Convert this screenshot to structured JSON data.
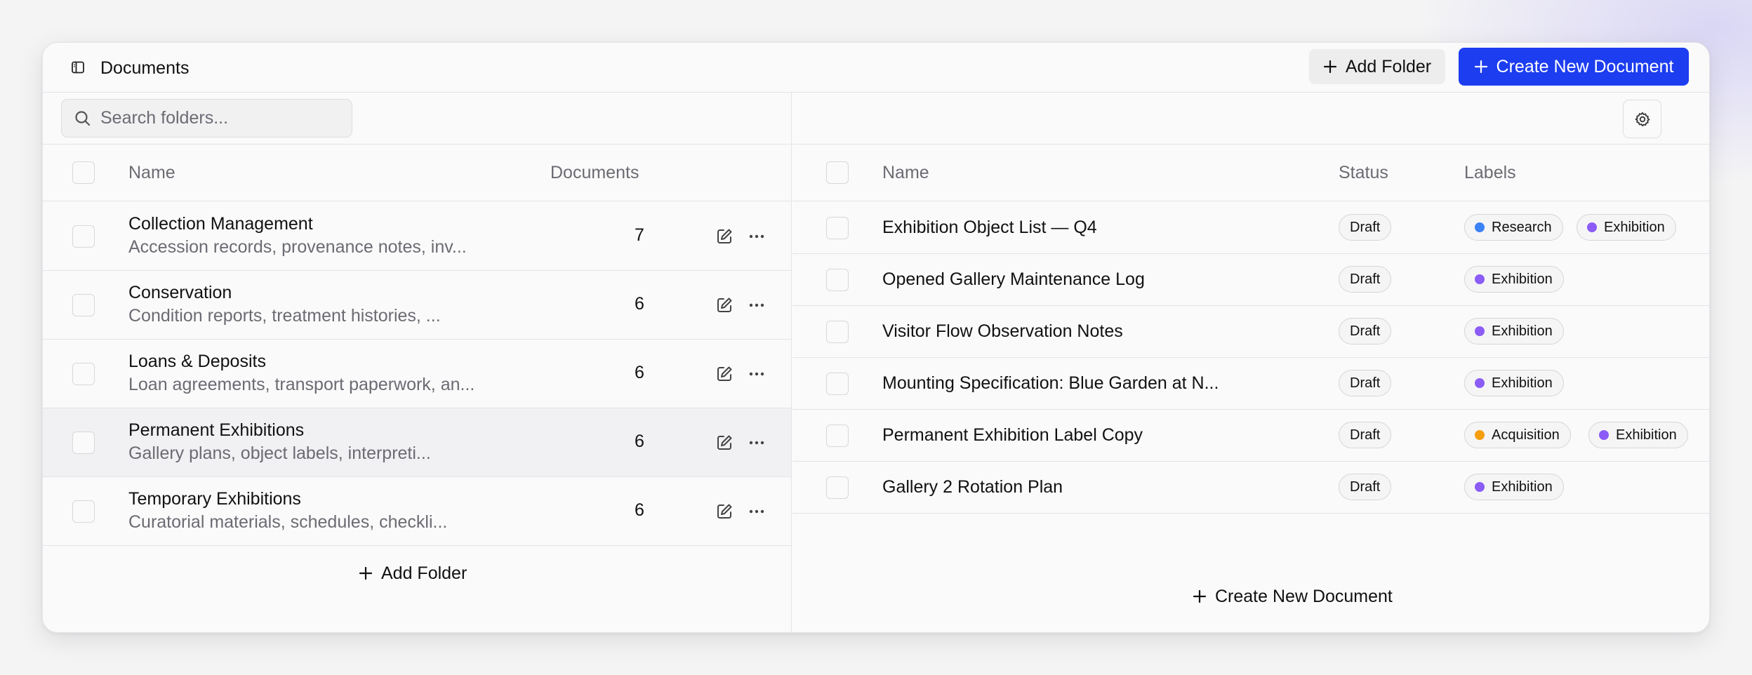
{
  "header": {
    "title": "Documents",
    "add_folder_label": "Add Folder",
    "create_document_label": "Create New Document"
  },
  "folders_panel": {
    "search_placeholder": "Search folders...",
    "columns": {
      "name": "Name",
      "documents": "Documents"
    },
    "rows": [
      {
        "name": "Collection Management",
        "description": "Accession records, provenance notes, inv...",
        "count": "7"
      },
      {
        "name": "Conservation",
        "description": "Condition reports, treatment histories, ...",
        "count": "6"
      },
      {
        "name": "Loans & Deposits",
        "description": "Loan agreements, transport paperwork, an...",
        "count": "6"
      },
      {
        "name": "Permanent Exhibitions",
        "description": "Gallery plans, object labels, interpreti...",
        "count": "6"
      },
      {
        "name": "Temporary Exhibitions",
        "description": "Curatorial materials, schedules, checkli...",
        "count": "6"
      }
    ],
    "add_folder_label": "Add Folder"
  },
  "documents_panel": {
    "columns": {
      "name": "Name",
      "status": "Status",
      "labels": "Labels"
    },
    "rows": [
      {
        "name": "Exhibition Object List — Q4",
        "status": "Draft",
        "labels": [
          "Research",
          "Exhibition"
        ]
      },
      {
        "name": "Opened Gallery Maintenance Log",
        "status": "Draft",
        "labels": [
          "Exhibition"
        ]
      },
      {
        "name": "Visitor Flow Observation Notes",
        "status": "Draft",
        "labels": [
          "Exhibition"
        ]
      },
      {
        "name": "Mounting Specification: Blue Garden at N...",
        "status": "Draft",
        "labels": [
          "Exhibition"
        ]
      },
      {
        "name": "Permanent Exhibition Label Copy",
        "status": "Draft",
        "labels": [
          "Acquisition",
          "Exhibition"
        ]
      },
      {
        "name": "Gallery 2 Rotation Plan",
        "status": "Draft",
        "labels": [
          "Exhibition"
        ]
      }
    ],
    "create_document_label": "Create New Document"
  },
  "label_colors": {
    "Research": "#3b82f6",
    "Exhibition": "#8b5cf6",
    "Acquisition": "#f59e0b"
  },
  "colors": {
    "primary": "#1d3df0"
  }
}
